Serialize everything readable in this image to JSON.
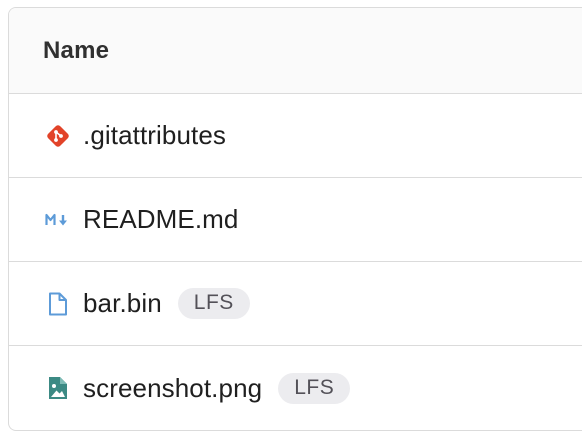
{
  "table": {
    "header_name": "Name"
  },
  "files": [
    {
      "name": ".gitattributes",
      "icon": "git-icon",
      "badge": ""
    },
    {
      "name": "README.md",
      "icon": "markdown-icon",
      "badge": ""
    },
    {
      "name": "bar.bin",
      "icon": "file-icon",
      "badge": "LFS"
    },
    {
      "name": "screenshot.png",
      "icon": "image-file-icon",
      "badge": "LFS"
    }
  ],
  "colors": {
    "git_icon": "#e24329",
    "markdown_icon": "#5d9bd8",
    "file_icon": "#5d9bd8",
    "image_icon": "#3c8a84",
    "border": "#dbdbdb",
    "header_bg": "#fafafa",
    "badge_bg": "#ececef"
  }
}
